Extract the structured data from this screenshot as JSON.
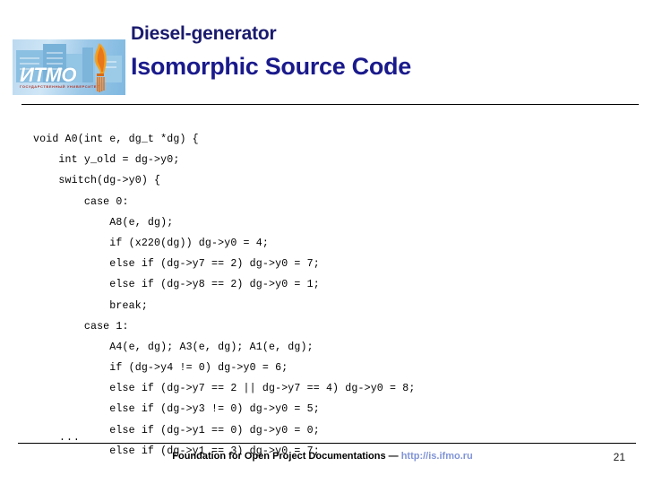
{
  "slide": {
    "title": "Diesel-generator",
    "subtitle": "Isomorphic Source Code",
    "page_number": "21"
  },
  "logo": {
    "name": "itmo-university-logo",
    "wordmark": "ИТМО",
    "subtext": "ГОСУДАРСТВЕННЫЙ УНИВЕРСИТЕТ"
  },
  "code": {
    "lines": [
      "void A0(int e, dg_t *dg) {",
      "    int y_old = dg->y0;",
      "    switch(dg->y0) {",
      "        case 0:",
      "            A8(e, dg);",
      "            if (x220(dg)) dg->y0 = 4;",
      "            else if (dg->y7 == 2) dg->y0 = 7;",
      "            else if (dg->y8 == 2) dg->y0 = 1;",
      "            break;",
      "        case 1:",
      "            A4(e, dg); A3(e, dg); A1(e, dg);",
      "            if (dg->y4 != 0) dg->y0 = 6;",
      "            else if (dg->y7 == 2 || dg->y7 == 4) dg->y0 = 8;",
      "            else if (dg->y3 != 0) dg->y0 = 5;",
      "            else if (dg->y1 == 0) dg->y0 = 0;",
      "            else if (dg->y1 == 3) dg->y0 = 7;"
    ],
    "continuation": "..."
  },
  "footer": {
    "text": "Foundation for Open Project Documentations — ",
    "url": "http://is.ifmo.ru"
  },
  "colors": {
    "title": "#1a1a6e",
    "subtitle": "#1a1a8c",
    "url": "#8094d6",
    "rule": "#000000",
    "background": "#ffffff"
  }
}
